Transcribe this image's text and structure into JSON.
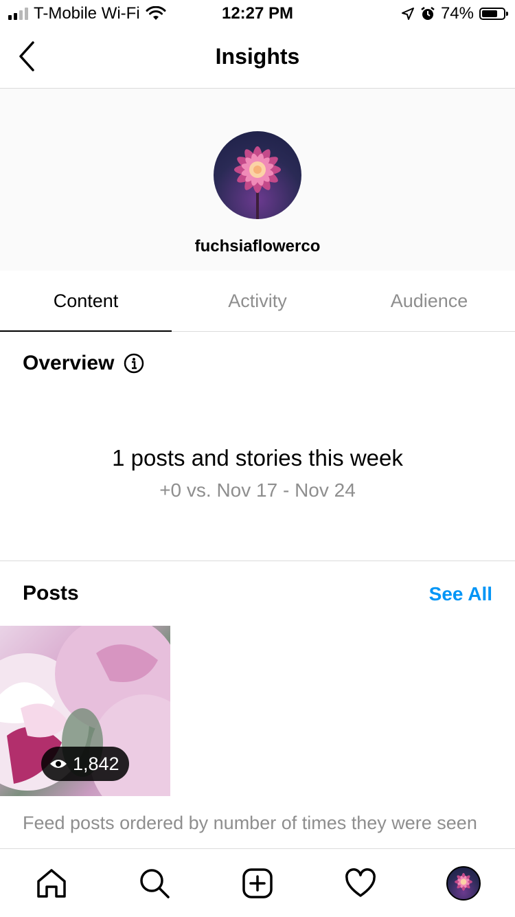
{
  "status_bar": {
    "carrier": "T-Mobile Wi-Fi",
    "time": "12:27 PM",
    "battery_pct": "74%",
    "battery_level": 0.74,
    "icons": [
      "signal-icon",
      "wifi-icon",
      "location-icon",
      "alarm-icon",
      "battery-icon"
    ]
  },
  "nav": {
    "title": "Insights",
    "back_icon": "chevron-left-icon"
  },
  "profile": {
    "username": "fuchsiaflowerco"
  },
  "tabs": [
    {
      "label": "Content",
      "active": true
    },
    {
      "label": "Activity",
      "active": false
    },
    {
      "label": "Audience",
      "active": false
    }
  ],
  "overview": {
    "title": "Overview",
    "headline": "1 posts and stories this week",
    "comparison": "+0 vs. Nov 17 - Nov 24"
  },
  "posts": {
    "title": "Posts",
    "see_all": "See All",
    "items": [
      {
        "views": "1,842"
      }
    ],
    "caption": "Feed posts ordered by number of times they were seen"
  },
  "tab_bar": {
    "items": [
      "home-icon",
      "search-icon",
      "new-post-icon",
      "activity-heart-icon",
      "profile-avatar"
    ]
  },
  "colors": {
    "link": "#0095f6",
    "muted_text": "#8e8e8e",
    "divider": "#dbdbdb",
    "header_bg": "#fafafa"
  }
}
